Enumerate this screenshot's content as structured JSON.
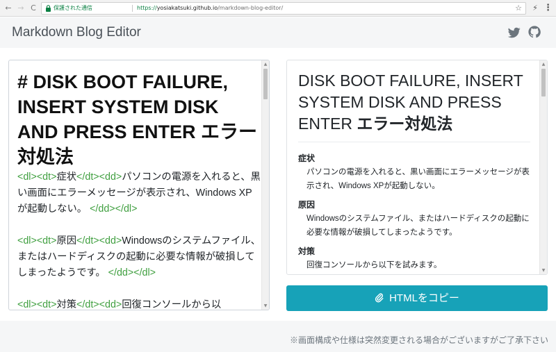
{
  "browser": {
    "nav": {
      "back": "←",
      "forward": "→",
      "reload": "C"
    },
    "secure_label": "保護された通信",
    "url_scheme": "https://",
    "url_host": "yosiakatsuki.github.io",
    "url_path": "/markdown-blog-editor/",
    "bookmark_icon": "☆",
    "extension_icon": "⚡",
    "menu_icon": "⋮"
  },
  "app": {
    "title": "Markdown Blog Editor",
    "icons": [
      "twitter-icon",
      "github-icon"
    ],
    "accent_color": "#17a2b8"
  },
  "editor": {
    "heading": "# DISK BOOT FAILURE, INSERT SYSTEM DISK AND PRESS ENTER エラー対処法",
    "blocks": [
      {
        "open": "<dl><dt>",
        "term": "症状",
        "mid": "</dt><dd>",
        "desc": "パソコンの電源を入れると、黒い画面にエラーメッセージが表示され、Windows XPが起動しない。",
        "close": "</dd></dl>"
      },
      {
        "open": "<dl><dt>",
        "term": "原因",
        "mid": "</dt><dd>",
        "desc": "Windowsのシステムファイル、またはハードディスクの起動に必要な情報が破損してしまったようです。",
        "close": "</dd></dl>"
      },
      {
        "open": "<dl><dt>",
        "term": "対策",
        "mid": "</dt><dd>",
        "desc": "回復コンソールから以"
      }
    ],
    "tag_color": "#3f9f3f"
  },
  "preview": {
    "heading_en": "DISK BOOT FAILURE, INSERT SYSTEM DISK AND PRESS ENTER ",
    "heading_jp": "エラー対処法",
    "items": [
      {
        "term": "症状",
        "desc": "パソコンの電源を入れると、黒い画面にエラーメッセージが表示され、Windows XPが起動しない。"
      },
      {
        "term": "原因",
        "desc": "Windowsのシステムファイル、またはハードディスクの起動に必要な情報が破損してしまったようです。"
      },
      {
        "term": "対策",
        "desc": "回復コンソールから以下を試みます。"
      }
    ]
  },
  "copy_button": {
    "label": "HTMLをコピー"
  },
  "footer": {
    "note": "※画面構成や仕様は突然変更される場合がございますがご了承下さい"
  }
}
